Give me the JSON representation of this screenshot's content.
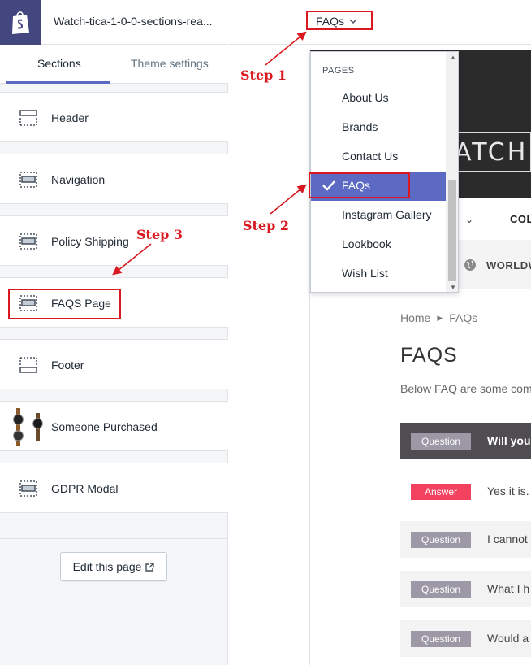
{
  "store": {
    "name": "Watch-tica-1-0-0-sections-rea..."
  },
  "tabs": {
    "sections": "Sections",
    "theme": "Theme settings"
  },
  "sections": [
    {
      "label": "Header",
      "icon": "header-layout-icon"
    },
    {
      "label": "Navigation",
      "icon": "navigation-layout-icon"
    },
    {
      "label": "Policy Shipping",
      "icon": "section-layout-icon"
    },
    {
      "label": "FAQS Page",
      "icon": "section-layout-icon"
    },
    {
      "label": "Footer",
      "icon": "footer-layout-icon"
    },
    {
      "label": "Someone Purchased",
      "icon": "watch-thumbnail"
    },
    {
      "label": "GDPR Modal",
      "icon": "section-layout-icon"
    }
  ],
  "edit_page": {
    "label": "Edit this page",
    "icon": "external-link-icon"
  },
  "page_selector": {
    "value": "FAQs",
    "icon": "chevron-down-icon"
  },
  "dropdown": {
    "heading": "PAGES",
    "items": [
      "About Us",
      "Brands",
      "Contact Us",
      "FAQs",
      "Instagram Gallery",
      "Lookbook",
      "Wish List"
    ],
    "selected": "FAQs"
  },
  "preview": {
    "logo": "WATCH",
    "nav_item": "COL",
    "shipping": "WORLDW",
    "breadcrumb": {
      "home": "Home",
      "current": "FAQs"
    },
    "title": "FAQS",
    "intro": "Below FAQ are some com",
    "qa": [
      {
        "type": "Question",
        "text": "Will your"
      },
      {
        "type": "Answer",
        "text": "Yes it is."
      },
      {
        "type": "Question",
        "text": "I cannot"
      },
      {
        "type": "Question",
        "text": "What I h"
      },
      {
        "type": "Question",
        "text": "Would a"
      }
    ]
  },
  "annotations": {
    "step1": "Step 1",
    "step2": "Step 2",
    "step3": "Step 3"
  },
  "colors": {
    "accent": "#5c6ac4",
    "logo_bg": "#43467f",
    "annotation": "#d9191f",
    "answer": "#f2425f",
    "question": "#9c98a6"
  }
}
